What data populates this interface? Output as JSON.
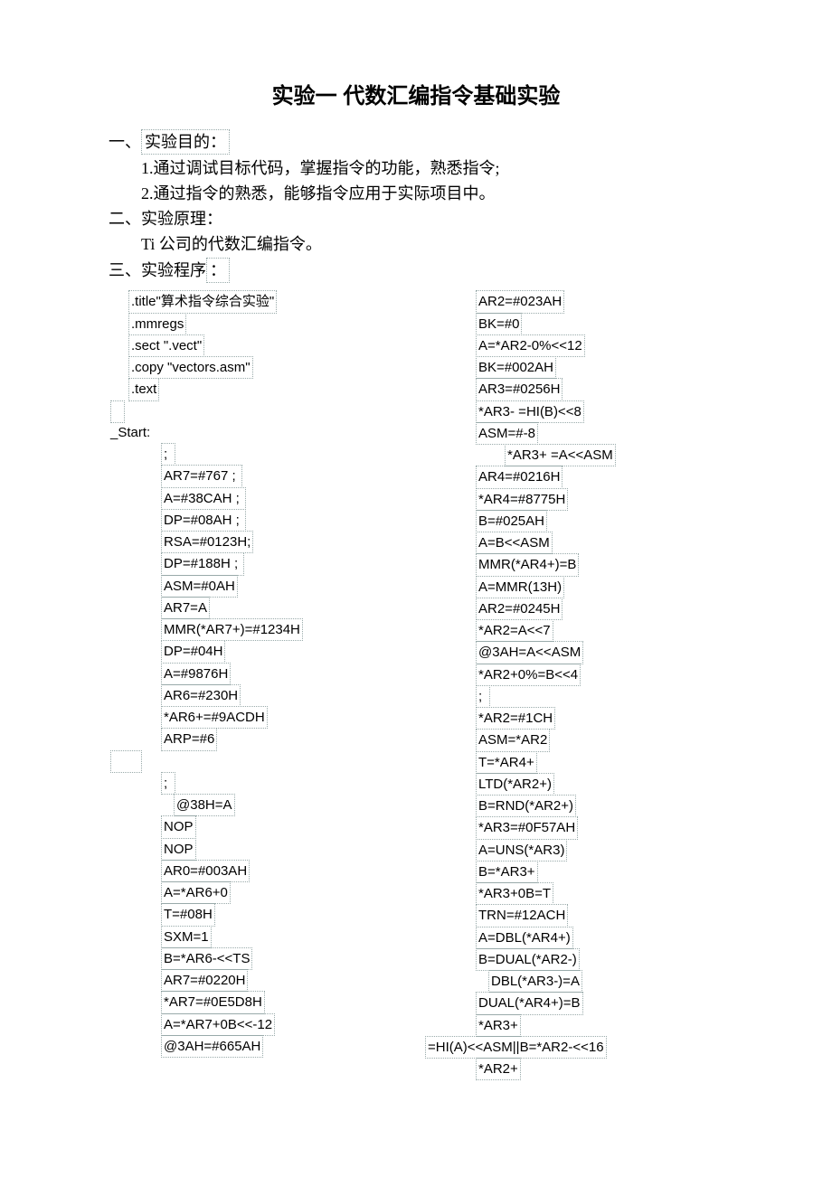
{
  "title": "实验一 代数汇编指令基础实验",
  "sec1": {
    "h": "一、",
    "label": "实验目的：",
    "l1": "1.通过调试目标代码，掌握指令的功能，熟悉指令;",
    "l2": "2.通过指令的熟悉，能够指令应用于实际项目中。"
  },
  "sec2": {
    "h": "二、实验原理：",
    "l1": "Ti 公司的代数汇编指令。"
  },
  "sec3": {
    "h": "三、实验程序",
    "colon": "："
  },
  "left": {
    "p0": ".title\"算术指令综合实验\"",
    "p1": ".mmregs",
    "p2": ".sect \".vect\"",
    "p3": ".copy \"vectors.asm\"",
    "p4": ".text",
    "start": "_Start:",
    "l0": ";",
    "l1": "AR7=#767   ;",
    "l2": "A=#38CAH   ;",
    "l3": "DP=#08AH   ;",
    "l4": "RSA=#0123H;",
    "l5": "DP=#188H   ;",
    "l6": "ASM=#0AH",
    "l7": "AR7=A",
    "l8": "MMR(*AR7+)=#1234H",
    "l9": "DP=#04H",
    "l10": "A=#9876H",
    "l11": "AR6=#230H",
    "l12": "*AR6+=#9ACDH",
    "l13": "ARP=#6",
    "l14": ";",
    "l15": "@38H=A",
    "l16a": "NOP",
    "l16b": "NOP",
    "l17": "AR0=#003AH",
    "l18": "A=*AR6+0",
    "l19": "T=#08H",
    "l20": "SXM=1",
    "l21": "B=*AR6-<<TS",
    "l22": "AR7=#0220H",
    "l23": "*AR7=#0E5D8H",
    "l24": "A=*AR7+0B<<-12",
    "l25": "@3AH=#665AH"
  },
  "right": {
    "r0": "AR2=#023AH",
    "r1": "BK=#0",
    "r2": "A=*AR2-0%<<12",
    "r3": "BK=#002AH",
    "r4": "AR3=#0256H",
    "r5": "*AR3- =HI(B)<<8",
    "r6": "ASM=#-8",
    "r7": "*AR3+ =A<<ASM",
    "r8": "AR4=#0216H",
    "r9": "*AR4=#8775H",
    "r10": "B=#025AH",
    "r11": "A=B<<ASM",
    "r12": "MMR(*AR4+)=B",
    "r13": "A=MMR(13H)",
    "r14": "AR2=#0245H",
    "r15": "*AR2=A<<7",
    "r16": "@3AH=A<<ASM",
    "r17": "*AR2+0%=B<<4",
    "r18": ";",
    "r19": "*AR2=#1CH",
    "r20": "ASM=*AR2",
    "r21": "T=*AR4+",
    "r22": "LTD(*AR2+)",
    "r23": "B=RND(*AR2+)",
    "r24": "*AR3=#0F57AH",
    "r25": "A=UNS(*AR3)",
    "r26": "B=*AR3+",
    "r27": "*AR3+0B=T",
    "r28": "TRN=#12ACH",
    "r29": "A=DBL(*AR4+)",
    "r30": "B=DUAL(*AR2-)",
    "r31": "DBL(*AR3-)=A",
    "r32": "DUAL(*AR4+)=B",
    "r33": "*AR3+",
    "r34": "=HI(A)<<ASM||B=*AR2-<<16",
    "r35": "*AR2+"
  }
}
